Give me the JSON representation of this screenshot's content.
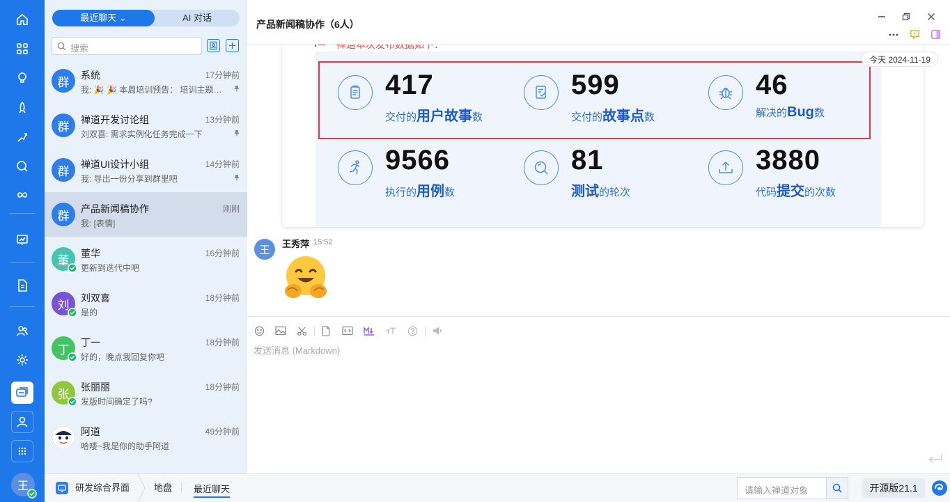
{
  "list_tabs": {
    "recent": "最近聊天",
    "ai": "AI 对话"
  },
  "search": {
    "placeholder": "搜索"
  },
  "chats": [
    {
      "name": "系统",
      "time": "17分钟前",
      "msg": "我: 🎉 🎉 本周培训预告： 培训主题：...",
      "avatar": "群",
      "color": "#2f7de8",
      "pinned": true,
      "online": false,
      "selected": false
    },
    {
      "name": "禅道开发讨论组",
      "time": "13分钟前",
      "msg": "刘双喜: 需求实例化任务完成一下",
      "avatar": "群",
      "color": "#2f7de8",
      "pinned": true,
      "online": false,
      "selected": false
    },
    {
      "name": "禅道UI设计小组",
      "time": "14分钟前",
      "msg": "我: 导出一份分享到群里吧",
      "avatar": "群",
      "color": "#2f7de8",
      "pinned": true,
      "online": false,
      "selected": false
    },
    {
      "name": "产品新闻稿协作",
      "time": "刚刚",
      "msg": "我: [表情]",
      "avatar": "群",
      "color": "#2f7de8",
      "pinned": false,
      "online": false,
      "selected": true
    },
    {
      "name": "董华",
      "time": "16分钟前",
      "msg": "更新到迭代中吧",
      "avatar": "董",
      "color": "#45c4b0",
      "pinned": false,
      "online": true,
      "selected": false
    },
    {
      "name": "刘双喜",
      "time": "18分钟前",
      "msg": "是的",
      "avatar": "刘",
      "color": "#7b52d6",
      "pinned": false,
      "online": true,
      "selected": false
    },
    {
      "name": "丁一",
      "time": "18分钟前",
      "msg": "好的，晚点我回复你吧",
      "avatar": "丁",
      "color": "#43c463",
      "pinned": false,
      "online": true,
      "selected": false
    },
    {
      "name": "张丽丽",
      "time": "18分钟前",
      "msg": "发版时间确定了吗?",
      "avatar": "张",
      "color": "#8fc83b",
      "pinned": false,
      "online": true,
      "selected": false
    },
    {
      "name": "阿道",
      "time": "49分钟前",
      "msg": "哈喽~我是你的助手阿道",
      "avatar": "",
      "color": "#ffffff",
      "pinned": false,
      "online": false,
      "selected": false
    }
  ],
  "header": {
    "title": "产品新闻稿协作（6人）"
  },
  "card": {
    "title": "禅道本次发布数据如下：",
    "stats": [
      {
        "num": "417",
        "pre": "交付的",
        "strong": "用户故事",
        "post": "数",
        "icon": "clipboard-icon"
      },
      {
        "num": "599",
        "pre": "交付的",
        "strong": "故事点",
        "post": "数",
        "icon": "checklist-icon"
      },
      {
        "num": "46",
        "pre": "解决的",
        "strong": "Bug",
        "post": "数",
        "icon": "bug-icon"
      },
      {
        "num": "9566",
        "pre": "执行的",
        "strong": "用例",
        "post": "数",
        "icon": "runner-icon"
      },
      {
        "num": "81",
        "pre": "",
        "strong": "测试",
        "post": "的轮次",
        "icon": "magnifier-icon"
      },
      {
        "num": "3880",
        "pre": "代码",
        "strong": "提交",
        "post": "的次数",
        "icon": "upload-icon"
      }
    ]
  },
  "date_pill": "今天 2024-11-19",
  "message": {
    "avatar": "王",
    "sender": "王秀萍",
    "time": "15:52"
  },
  "composer": {
    "placeholder": "发送消息 (Markdown)"
  },
  "rail": {
    "avatar": "王"
  },
  "bottom": {
    "crumbs": [
      "研发综合界面",
      "地盘",
      "最近聊天"
    ],
    "object_search_placeholder": "请输入禅道对象",
    "version": "开源版21.1"
  },
  "colors": {
    "primary": "#1e78ea",
    "list_bg": "#e9f1fb",
    "highlight_red": "#e23744"
  }
}
